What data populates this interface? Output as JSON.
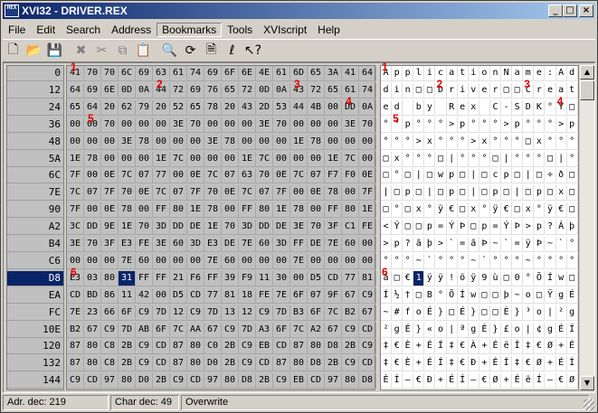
{
  "window": {
    "app_icon_text": "HEX",
    "title": "XVI32 - DRIVER.REX",
    "minimize": "_",
    "maximize": "□",
    "close": "×"
  },
  "menu": [
    "File",
    "Edit",
    "Search",
    "Address",
    "Bookmarks",
    "Tools",
    "XVIscript",
    "Help"
  ],
  "menu_active_index": 4,
  "toolbar": [
    {
      "name": "new-file-icon",
      "glyph": "🗋",
      "enabled": true
    },
    {
      "name": "open-folder-icon",
      "glyph": "📂",
      "enabled": true
    },
    {
      "name": "save-icon",
      "glyph": "💾",
      "enabled": true
    },
    {
      "name": "delete-icon",
      "glyph": "✖",
      "enabled": false
    },
    {
      "name": "cut-icon",
      "glyph": "✂",
      "enabled": false
    },
    {
      "name": "copy-icon",
      "glyph": "⧉",
      "enabled": false
    },
    {
      "name": "paste-icon",
      "glyph": "📋",
      "enabled": true
    },
    {
      "name": "find-icon",
      "glyph": "🔍",
      "enabled": true
    },
    {
      "name": "replace-icon",
      "glyph": "⟳",
      "enabled": true
    },
    {
      "name": "properties-icon",
      "glyph": "🗎",
      "enabled": true
    },
    {
      "name": "script-icon",
      "glyph": "ℓ",
      "enabled": true
    },
    {
      "name": "context-help-icon",
      "glyph": "↖?",
      "enabled": true
    }
  ],
  "addresses": [
    "0",
    "12",
    "24",
    "36",
    "48",
    "5A",
    "6C",
    "7E",
    "90",
    "A2",
    "B4",
    "C6",
    "D8",
    "EA",
    "FC",
    "10E",
    "120",
    "132",
    "144"
  ],
  "selected_row": 12,
  "selected_col": 3,
  "hex_rows": [
    [
      "41",
      "70",
      "70",
      "6C",
      "69",
      "63",
      "61",
      "74",
      "69",
      "6F",
      "6E",
      "4E",
      "61",
      "6D",
      "65",
      "3A",
      "41",
      "64"
    ],
    [
      "64",
      "69",
      "6E",
      "0D",
      "0A",
      "44",
      "72",
      "69",
      "76",
      "65",
      "72",
      "0D",
      "0A",
      "43",
      "72",
      "65",
      "61",
      "74"
    ],
    [
      "65",
      "64",
      "20",
      "62",
      "79",
      "20",
      "52",
      "65",
      "78",
      "20",
      "43",
      "2D",
      "53",
      "44",
      "4B",
      "00",
      "DD",
      "0A"
    ],
    [
      "00",
      "00",
      "70",
      "00",
      "00",
      "00",
      "3E",
      "70",
      "00",
      "00",
      "00",
      "3E",
      "70",
      "00",
      "00",
      "00",
      "3E",
      "70"
    ],
    [
      "00",
      "00",
      "00",
      "3E",
      "78",
      "00",
      "00",
      "00",
      "3E",
      "78",
      "00",
      "00",
      "00",
      "1E",
      "78",
      "00",
      "00",
      "00"
    ],
    [
      "1E",
      "78",
      "00",
      "00",
      "00",
      "1E",
      "7C",
      "00",
      "00",
      "00",
      "1E",
      "7C",
      "00",
      "00",
      "00",
      "1E",
      "7C",
      "00"
    ],
    [
      "7F",
      "00",
      "0E",
      "7C",
      "07",
      "77",
      "00",
      "0E",
      "7C",
      "07",
      "63",
      "70",
      "0E",
      "7C",
      "07",
      "F7",
      "F0",
      "0E"
    ],
    [
      "7C",
      "07",
      "7F",
      "70",
      "0E",
      "7C",
      "07",
      "7F",
      "70",
      "0E",
      "7C",
      "07",
      "7F",
      "00",
      "0E",
      "78",
      "00",
      "7F"
    ],
    [
      "7F",
      "00",
      "0E",
      "78",
      "00",
      "FF",
      "80",
      "1E",
      "78",
      "00",
      "FF",
      "80",
      "1E",
      "78",
      "00",
      "FF",
      "80",
      "1E"
    ],
    [
      "3C",
      "DD",
      "9E",
      "1E",
      "70",
      "3D",
      "DD",
      "DE",
      "1E",
      "70",
      "3D",
      "DD",
      "DE",
      "3E",
      "70",
      "3F",
      "C1",
      "FE"
    ],
    [
      "3E",
      "70",
      "3F",
      "E3",
      "FE",
      "3E",
      "60",
      "3D",
      "E3",
      "DE",
      "7E",
      "60",
      "3D",
      "FF",
      "DE",
      "7E",
      "60",
      "00"
    ],
    [
      "00",
      "00",
      "00",
      "7E",
      "60",
      "00",
      "00",
      "00",
      "7E",
      "60",
      "00",
      "00",
      "00",
      "7E",
      "00",
      "00",
      "00",
      "00"
    ],
    [
      "E3",
      "03",
      "80",
      "31",
      "FF",
      "FF",
      "21",
      "F6",
      "FF",
      "39",
      "F9",
      "11",
      "30",
      "00",
      "D5",
      "CD",
      "77",
      "81"
    ],
    [
      "CD",
      "BD",
      "86",
      "11",
      "42",
      "00",
      "D5",
      "CD",
      "77",
      "81",
      "18",
      "FE",
      "7E",
      "6F",
      "07",
      "9F",
      "67",
      "C9"
    ],
    [
      "7E",
      "23",
      "66",
      "6F",
      "C9",
      "7D",
      "12",
      "C9",
      "7D",
      "13",
      "12",
      "C9",
      "7D",
      "B3",
      "6F",
      "7C",
      "B2",
      "67"
    ],
    [
      "B2",
      "67",
      "C9",
      "7D",
      "AB",
      "6F",
      "7C",
      "AA",
      "67",
      "C9",
      "7D",
      "A3",
      "6F",
      "7C",
      "A2",
      "67",
      "C9",
      "CD"
    ],
    [
      "87",
      "80",
      "C8",
      "2B",
      "C9",
      "CD",
      "87",
      "80",
      "C0",
      "2B",
      "C9",
      "EB",
      "CD",
      "87",
      "80",
      "D8",
      "2B",
      "C9"
    ],
    [
      "87",
      "80",
      "C8",
      "2B",
      "C9",
      "CD",
      "87",
      "80",
      "D0",
      "2B",
      "C9",
      "CD",
      "87",
      "80",
      "D8",
      "2B",
      "C9",
      "CD"
    ],
    [
      "C9",
      "CD",
      "97",
      "80",
      "D0",
      "2B",
      "C9",
      "CD",
      "97",
      "80",
      "D8",
      "2B",
      "C9",
      "EB",
      "CD",
      "97",
      "80",
      "D8"
    ]
  ],
  "char_rows": [
    [
      "A",
      "p",
      "p",
      "l",
      "i",
      "c",
      "a",
      "t",
      "i",
      "o",
      "n",
      "N",
      "a",
      "m",
      "e",
      ":",
      "A",
      "d"
    ],
    [
      "d",
      "i",
      "n",
      "□",
      "□",
      "D",
      "r",
      "i",
      "v",
      "e",
      "r",
      "□",
      "□",
      "C",
      "r",
      "e",
      "a",
      "t"
    ],
    [
      "e",
      "d",
      " ",
      "b",
      "y",
      " ",
      "R",
      "e",
      "x",
      " ",
      "C",
      "-",
      "S",
      "D",
      "K",
      "°",
      "Ý",
      "□"
    ],
    [
      "°",
      "°",
      "p",
      "°",
      "°",
      "°",
      ">",
      "p",
      "°",
      "°",
      "°",
      ">",
      "p",
      "°",
      "°",
      "°",
      ">",
      "p"
    ],
    [
      "°",
      "°",
      "°",
      ">",
      "x",
      "°",
      "°",
      "°",
      ">",
      "x",
      "°",
      "°",
      "°",
      "□",
      "x",
      "°",
      "°",
      "°"
    ],
    [
      "□",
      "x",
      "°",
      "°",
      "°",
      "□",
      "|",
      "°",
      "°",
      "°",
      "□",
      "|",
      "°",
      "°",
      "°",
      "□",
      "|",
      "°"
    ],
    [
      "□",
      "°",
      "□",
      "|",
      "□",
      "w",
      "p",
      "□",
      "|",
      "□",
      "c",
      "p",
      "□",
      "|",
      "□",
      "÷",
      "ð",
      "□"
    ],
    [
      "|",
      "□",
      "p",
      "□",
      "|",
      "□",
      "p",
      "□",
      "|",
      "□",
      "p",
      "□",
      "|",
      "□",
      "p",
      "□",
      "x",
      "□"
    ],
    [
      "□",
      "°",
      "□",
      "x",
      "°",
      "ÿ",
      "€",
      "□",
      "x",
      "°",
      "ÿ",
      "€",
      "□",
      "x",
      "°",
      "ÿ",
      "€",
      "□"
    ],
    [
      "<",
      "Ý",
      "□",
      "□",
      "p",
      "=",
      "Ý",
      "Þ",
      "□",
      "p",
      "=",
      "Ý",
      "Þ",
      ">",
      "p",
      "?",
      "Á",
      "þ"
    ],
    [
      ">",
      "p",
      "?",
      "ã",
      "þ",
      ">",
      "`",
      "=",
      "ã",
      "Þ",
      "~",
      "`",
      "=",
      "ÿ",
      "Þ",
      "~",
      "`",
      "°"
    ],
    [
      "°",
      "°",
      "°",
      "~",
      "`",
      "°",
      "°",
      "°",
      "~",
      "`",
      "°",
      "°",
      "°",
      "~",
      "°",
      "°",
      "°",
      "°"
    ],
    [
      "ã",
      "□",
      "€",
      "1",
      "ÿ",
      "ÿ",
      "!",
      "ö",
      "ÿ",
      "9",
      "ù",
      "□",
      "0",
      "°",
      "Õ",
      "Í",
      "w",
      "□"
    ],
    [
      "Í",
      "½",
      "†",
      "□",
      "B",
      "°",
      "Õ",
      "Í",
      "w",
      "□",
      "□",
      "þ",
      "~",
      "o",
      "□",
      "Ÿ",
      "g",
      "É"
    ],
    [
      "~",
      "#",
      "f",
      "o",
      "É",
      "}",
      "□",
      "É",
      "}",
      "□",
      "□",
      "É",
      "}",
      "³",
      "o",
      "|",
      "²",
      "g"
    ],
    [
      "²",
      "g",
      "É",
      "}",
      "«",
      "o",
      "|",
      "ª",
      "g",
      "É",
      "}",
      "£",
      "o",
      "|",
      "¢",
      "g",
      "É",
      "Í"
    ],
    [
      "‡",
      "€",
      "È",
      "+",
      "É",
      "Í",
      "‡",
      "€",
      "À",
      "+",
      "É",
      "ë",
      "Í",
      "‡",
      "€",
      "Ø",
      "+",
      "É"
    ],
    [
      "‡",
      "€",
      "È",
      "+",
      "É",
      "Í",
      "‡",
      "€",
      "Ð",
      "+",
      "É",
      "Í",
      "‡",
      "€",
      "Ø",
      "+",
      "É",
      "Í"
    ],
    [
      "É",
      "Í",
      "—",
      "€",
      "Ð",
      "+",
      "É",
      "Í",
      "—",
      "€",
      "Ø",
      "+",
      "É",
      "ë",
      "Í",
      "—",
      "€",
      "Ø"
    ]
  ],
  "markers": [
    {
      "text": "1",
      "area": "hex",
      "row": 0,
      "col": 0
    },
    {
      "text": "2",
      "area": "hex",
      "row": 1,
      "col": 5
    },
    {
      "text": "3",
      "area": "hex",
      "row": 1,
      "col": 13
    },
    {
      "text": "4",
      "area": "hex",
      "row": 2,
      "col": 16
    },
    {
      "text": "5",
      "area": "hex",
      "row": 3,
      "col": 1
    },
    {
      "text": "6",
      "area": "hex",
      "row": 12,
      "col": 0
    },
    {
      "text": "1",
      "area": "chr",
      "row": 0,
      "col": 0
    },
    {
      "text": "2",
      "area": "chr",
      "row": 1,
      "col": 5
    },
    {
      "text": "3",
      "area": "chr",
      "row": 1,
      "col": 13
    },
    {
      "text": "4",
      "area": "chr",
      "row": 2,
      "col": 16
    },
    {
      "text": "5",
      "area": "chr",
      "row": 3,
      "col": 1
    },
    {
      "text": "6",
      "area": "chr",
      "row": 12,
      "col": 0
    }
  ],
  "status": {
    "address": "Adr. dec: 219",
    "char": "Char dec: 49",
    "mode": "Overwrite"
  },
  "colors": {
    "selection": "#0a246a",
    "marker": "#e00000"
  }
}
